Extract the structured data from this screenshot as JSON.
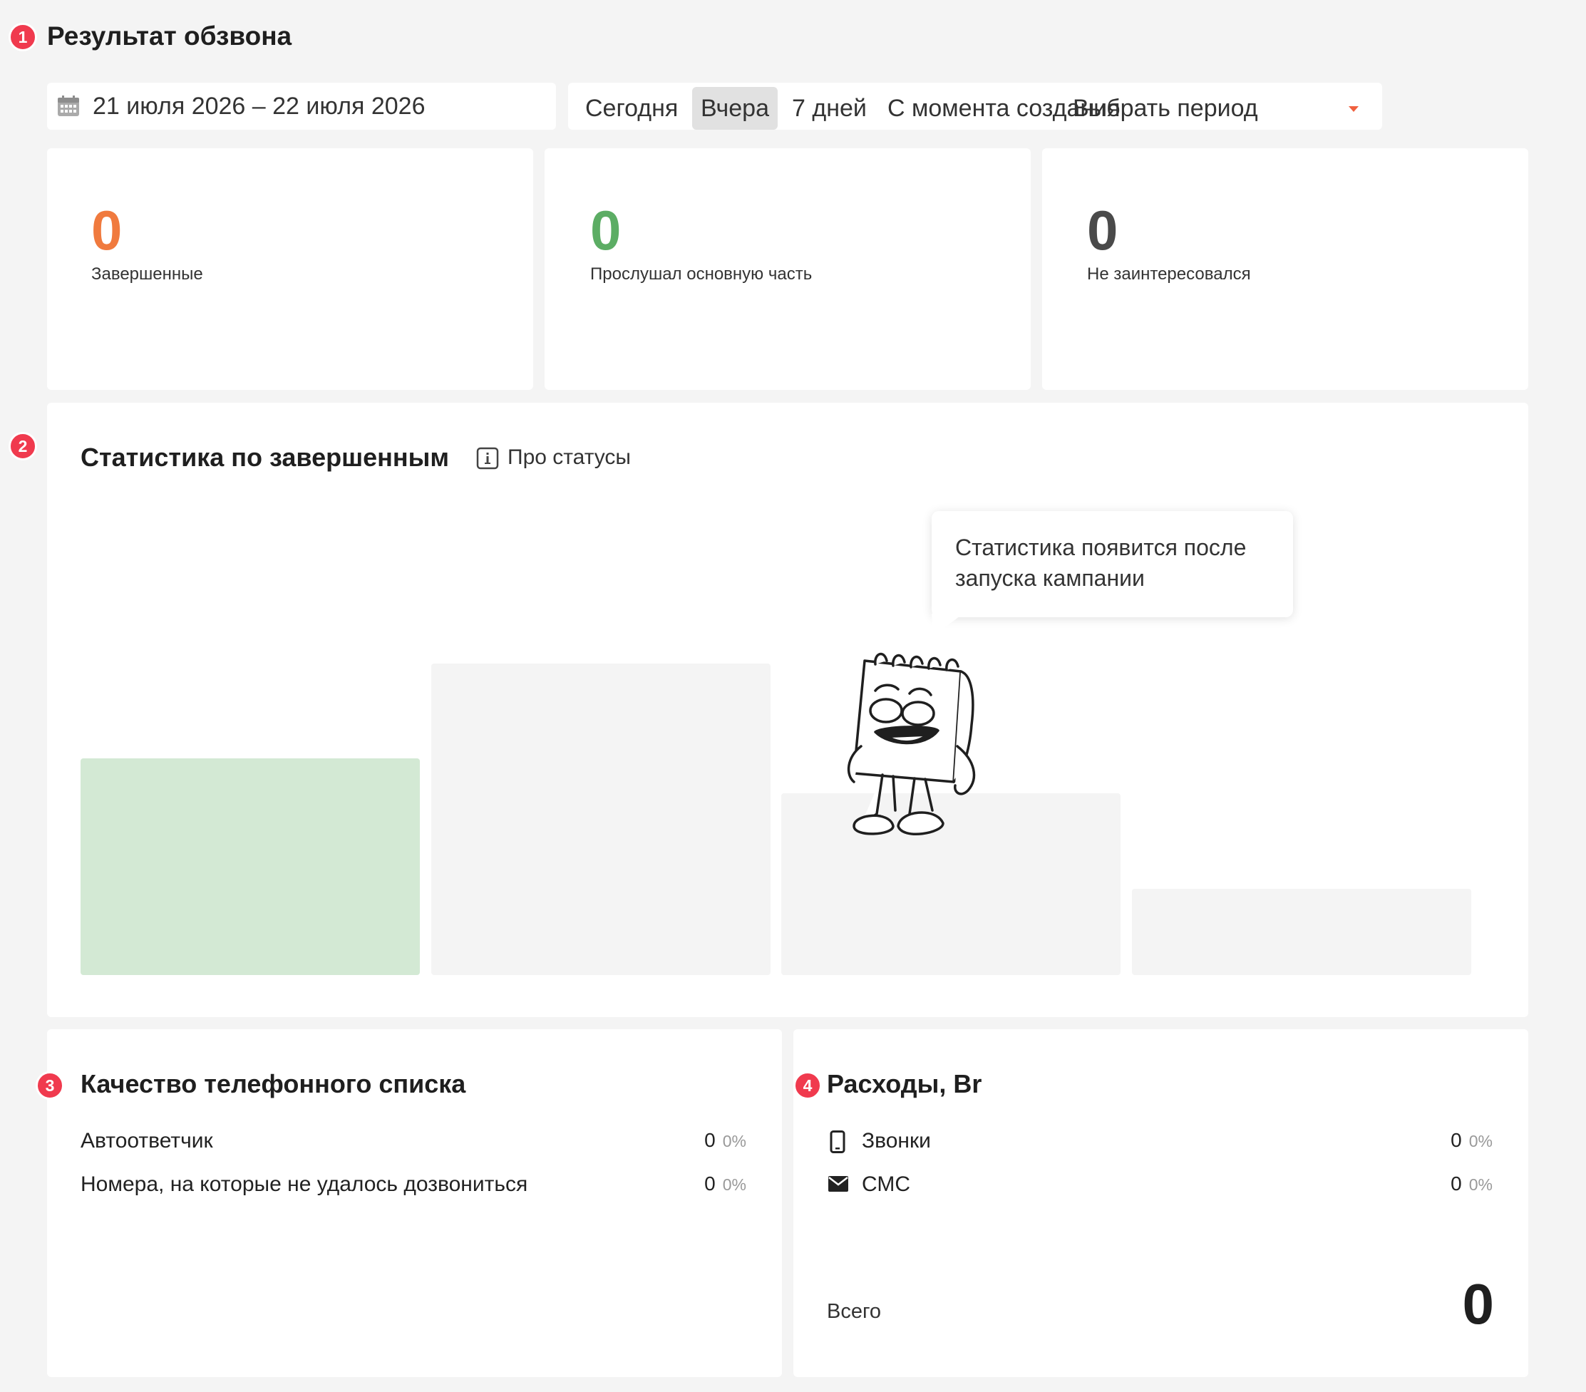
{
  "section1": {
    "number": "1",
    "title": "Результат обзвона"
  },
  "date_range": {
    "icon": "calendar-icon",
    "value": "21 июля 2026 – 22 июля 2026"
  },
  "periods": [
    {
      "label": "Сегодня",
      "active": false
    },
    {
      "label": "Вчера",
      "active": true
    },
    {
      "label": "7 дней",
      "active": false
    },
    {
      "label": "С момента создания",
      "active": false
    },
    {
      "label": "Выбрать период",
      "active": false
    }
  ],
  "period_dropdown_icon": "caret-down-icon",
  "kpis": [
    {
      "value": "0",
      "label": "Завершенные",
      "color": "#f07a3e"
    },
    {
      "value": "0",
      "label": "Прослушал основную часть",
      "color": "#5cad64"
    },
    {
      "value": "0",
      "label": "Не заинтересовался",
      "color": "#4a4a4a"
    }
  ],
  "section2": {
    "number": "2",
    "title": "Статистика по завершенным",
    "info_icon": "info-icon",
    "info_link": "Про статусы"
  },
  "placeholder_chart": {
    "bars": [
      {
        "level": 0.5,
        "color": "#d3e9d4"
      },
      {
        "level": 0.72,
        "color": "#f4f4f4"
      },
      {
        "level": 0.42,
        "color": "#f4f4f4"
      },
      {
        "level": 0.2,
        "color": "#f4f4f4"
      }
    ]
  },
  "tooltip": {
    "line1": "Статистика появится после",
    "line2": "запуска кампании"
  },
  "mascot": "notepad-mascot-illustration",
  "section3": {
    "number": "3",
    "title": "Качество телефонного списка",
    "rows": [
      {
        "label": "Автоответчик",
        "value": "0",
        "percent": "0%"
      },
      {
        "label": "Номера, на которые не удалось дозвониться",
        "value": "0",
        "percent": "0%"
      }
    ]
  },
  "section4": {
    "number": "4",
    "title": "Расходы, Br",
    "rows": [
      {
        "icon": "phone-icon",
        "label": "Звонки",
        "value": "0",
        "percent": "0%"
      },
      {
        "icon": "envelope-icon",
        "label": "СМС",
        "value": "0",
        "percent": "0%"
      }
    ],
    "total_label": "Всего",
    "total_value": "0"
  },
  "colors": {
    "badge": "#f03a4e",
    "accent_caret": "#f0603e",
    "background": "#f4f4f4",
    "card": "#ffffff"
  }
}
